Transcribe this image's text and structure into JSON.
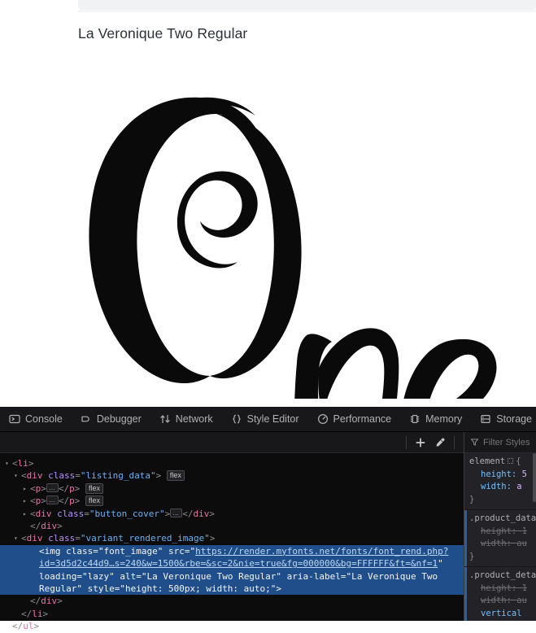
{
  "page": {
    "font_title": "La Veronique Two Regular",
    "specimen_text": "One",
    "background": "#ffffff",
    "text_color": "#2b3137",
    "band_color": "#f1f2f4"
  },
  "devtools": {
    "theme": "dark",
    "accent_selection": "#204e8a",
    "tabs": [
      {
        "label": "Console",
        "icon": "console-icon",
        "active": false
      },
      {
        "label": "Debugger",
        "icon": "debugger-icon",
        "active": false
      },
      {
        "label": "Network",
        "icon": "network-icon",
        "active": false
      },
      {
        "label": "Style Editor",
        "icon": "style-editor-icon",
        "active": false
      },
      {
        "label": "Performance",
        "icon": "performance-icon",
        "active": false
      },
      {
        "label": "Memory",
        "icon": "memory-icon",
        "active": false
      },
      {
        "label": "Storage",
        "icon": "storage-icon",
        "active": false
      }
    ],
    "markup_toolbar": {
      "add_rule_icon": "plus-icon",
      "eyedropper_icon": "eyedropper-icon"
    },
    "markup_tree": [
      {
        "indent": 0,
        "twisty": "open",
        "parts": [
          {
            "t": "pun",
            "v": "<"
          },
          {
            "t": "tag",
            "v": "li"
          },
          {
            "t": "pun",
            "v": ">"
          }
        ]
      },
      {
        "indent": 1,
        "twisty": "open",
        "parts": [
          {
            "t": "pun",
            "v": "<"
          },
          {
            "t": "tag",
            "v": "div"
          },
          {
            "t": "sp",
            "v": " "
          },
          {
            "t": "attn",
            "v": "class"
          },
          {
            "t": "pun",
            "v": "="
          },
          {
            "t": "attv",
            "v": "\"listing_data\""
          },
          {
            "t": "pun",
            "v": ">"
          },
          {
            "t": "sp",
            "v": " "
          },
          {
            "t": "badge",
            "v": "flex"
          }
        ]
      },
      {
        "indent": 2,
        "twisty": "closed",
        "parts": [
          {
            "t": "pun",
            "v": "<"
          },
          {
            "t": "tag",
            "v": "p"
          },
          {
            "t": "pun",
            "v": ">"
          },
          {
            "t": "ellip",
            "v": "…"
          },
          {
            "t": "pun",
            "v": "</"
          },
          {
            "t": "tag",
            "v": "p"
          },
          {
            "t": "pun",
            "v": ">"
          },
          {
            "t": "sp",
            "v": " "
          },
          {
            "t": "badge",
            "v": "flex"
          }
        ]
      },
      {
        "indent": 2,
        "twisty": "closed",
        "parts": [
          {
            "t": "pun",
            "v": "<"
          },
          {
            "t": "tag",
            "v": "p"
          },
          {
            "t": "pun",
            "v": ">"
          },
          {
            "t": "ellip",
            "v": "…"
          },
          {
            "t": "pun",
            "v": "</"
          },
          {
            "t": "tag",
            "v": "p"
          },
          {
            "t": "pun",
            "v": ">"
          },
          {
            "t": "sp",
            "v": " "
          },
          {
            "t": "badge",
            "v": "flex"
          }
        ]
      },
      {
        "indent": 2,
        "twisty": "closed",
        "parts": [
          {
            "t": "pun",
            "v": "<"
          },
          {
            "t": "tag",
            "v": "div"
          },
          {
            "t": "sp",
            "v": " "
          },
          {
            "t": "attn",
            "v": "class"
          },
          {
            "t": "pun",
            "v": "="
          },
          {
            "t": "attv",
            "v": "\"button_cover\""
          },
          {
            "t": "pun",
            "v": ">"
          },
          {
            "t": "ellip",
            "v": "…"
          },
          {
            "t": "pun",
            "v": "</"
          },
          {
            "t": "tag",
            "v": "div"
          },
          {
            "t": "pun",
            "v": ">"
          }
        ]
      },
      {
        "indent": 2,
        "twisty": "none",
        "parts": [
          {
            "t": "pun",
            "v": "</"
          },
          {
            "t": "tag",
            "v": "div"
          },
          {
            "t": "pun",
            "v": ">"
          }
        ]
      },
      {
        "indent": 1,
        "twisty": "open",
        "parts": [
          {
            "t": "pun",
            "v": "<"
          },
          {
            "t": "tag",
            "v": "div"
          },
          {
            "t": "sp",
            "v": " "
          },
          {
            "t": "attn",
            "v": "class"
          },
          {
            "t": "pun",
            "v": "="
          },
          {
            "t": "attv",
            "v": "\"variant_rendered_image\""
          },
          {
            "t": "pun",
            "v": ">"
          }
        ]
      },
      {
        "indent": 3,
        "twisty": "none",
        "selected": true,
        "parts": [
          {
            "t": "pun",
            "v": "<"
          },
          {
            "t": "tag",
            "v": "img"
          },
          {
            "t": "sp",
            "v": " "
          },
          {
            "t": "attn",
            "v": "class"
          },
          {
            "t": "pun",
            "v": "="
          },
          {
            "t": "attv",
            "v": "\"font_image\""
          },
          {
            "t": "sp",
            "v": " "
          },
          {
            "t": "attn",
            "v": "src"
          },
          {
            "t": "pun",
            "v": "="
          },
          {
            "t": "attv",
            "v": "\""
          },
          {
            "t": "lnk",
            "v": "https://render.myfonts.net/fonts/font_rend.php?"
          }
        ]
      },
      {
        "indent": 3,
        "twisty": "none",
        "selected": true,
        "parts": [
          {
            "t": "lnk",
            "v": "id=3d5d2c44d9…s=240&w=1500&rbe=&sc=2&nie=true&fg=000000&bg=FFFFFF&ft=&nf=1"
          },
          {
            "t": "attv",
            "v": "\""
          }
        ]
      },
      {
        "indent": 3,
        "twisty": "none",
        "selected": true,
        "parts": [
          {
            "t": "attn",
            "v": "loading"
          },
          {
            "t": "pun",
            "v": "="
          },
          {
            "t": "attv",
            "v": "\"lazy\""
          },
          {
            "t": "sp",
            "v": " "
          },
          {
            "t": "attn",
            "v": "alt"
          },
          {
            "t": "pun",
            "v": "="
          },
          {
            "t": "attv",
            "v": "\"La Veronique Two Regular\""
          },
          {
            "t": "sp",
            "v": " "
          },
          {
            "t": "attn",
            "v": "aria-label"
          },
          {
            "t": "pun",
            "v": "="
          },
          {
            "t": "attv",
            "v": "\"La Veronique Two"
          }
        ]
      },
      {
        "indent": 3,
        "twisty": "none",
        "selected": true,
        "parts": [
          {
            "t": "attv",
            "v": "Regular\""
          },
          {
            "t": "sp",
            "v": " "
          },
          {
            "t": "attn",
            "v": "style"
          },
          {
            "t": "pun",
            "v": "="
          },
          {
            "t": "attv",
            "v": "\"height: 500px; width: auto;\""
          },
          {
            "t": "pun",
            "v": ">"
          }
        ]
      },
      {
        "indent": 2,
        "twisty": "none",
        "parts": [
          {
            "t": "pun",
            "v": "</"
          },
          {
            "t": "tag",
            "v": "div"
          },
          {
            "t": "pun",
            "v": ">"
          }
        ]
      },
      {
        "indent": 1,
        "twisty": "none",
        "parts": [
          {
            "t": "pun",
            "v": "</"
          },
          {
            "t": "tag",
            "v": "li"
          },
          {
            "t": "pun",
            "v": ">"
          }
        ]
      },
      {
        "indent": 0,
        "twisty": "none",
        "parts": [
          {
            "t": "pun",
            "v": "</"
          },
          {
            "t": "tag",
            "v": "ul"
          },
          {
            "t": "pun",
            "v": ">"
          }
        ]
      }
    ],
    "rules_pane": {
      "filter_placeholder": "Filter Styles",
      "filter_icon": "filter-icon",
      "rules": [
        {
          "selector": "element",
          "has_swatch": true,
          "declarations": [
            {
              "prop": "height",
              "value": "5",
              "struck": false
            },
            {
              "prop": "width",
              "value": "a",
              "struck": false
            }
          ]
        },
        {
          "selector": ".product_data",
          "has_swatch": false,
          "declarations": [
            {
              "prop": "height",
              "value": "1",
              "struck": true
            },
            {
              "prop": "width",
              "value": "au",
              "struck": true
            }
          ]
        },
        {
          "selector": ".product_deta",
          "has_swatch": false,
          "declarations": [
            {
              "prop": "height",
              "value": "1",
              "struck": true
            },
            {
              "prop": "width",
              "value": "au",
              "struck": true
            },
            {
              "prop": "vertical",
              "value": "",
              "struck": false
            }
          ]
        }
      ]
    }
  }
}
